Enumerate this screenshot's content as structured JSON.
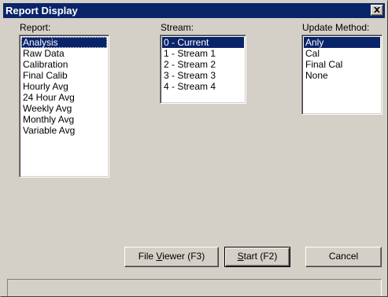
{
  "window": {
    "title": "Report Display",
    "close_glyph": "×"
  },
  "report": {
    "label": "Report:",
    "items": [
      "Analysis",
      "Raw Data",
      "Calibration",
      "Final Calib",
      "Hourly Avg",
      "24 Hour Avg",
      "Weekly Avg",
      "Monthly Avg",
      "Variable Avg"
    ],
    "selected_index": 0
  },
  "stream": {
    "label": "Stream:",
    "items": [
      "0 - Current",
      "1 - Stream 1",
      "2 - Stream 2",
      "3 - Stream 3",
      "4 - Stream 4"
    ],
    "selected_index": 0
  },
  "update_method": {
    "label": "Update Method:",
    "items": [
      "Anly",
      "Cal",
      "Final Cal",
      "None"
    ],
    "selected_index": 0
  },
  "buttons": {
    "file_viewer": {
      "pre": "File ",
      "accel": "V",
      "post": "iewer (F3)"
    },
    "start": {
      "pre": "",
      "accel": "S",
      "post": "tart (F2)"
    },
    "cancel": {
      "label": "Cancel"
    }
  },
  "colors": {
    "titlebar": "#0a246a",
    "face": "#d4d0c8",
    "selection": "#0a246a"
  },
  "icons": {
    "close": "close-icon"
  }
}
